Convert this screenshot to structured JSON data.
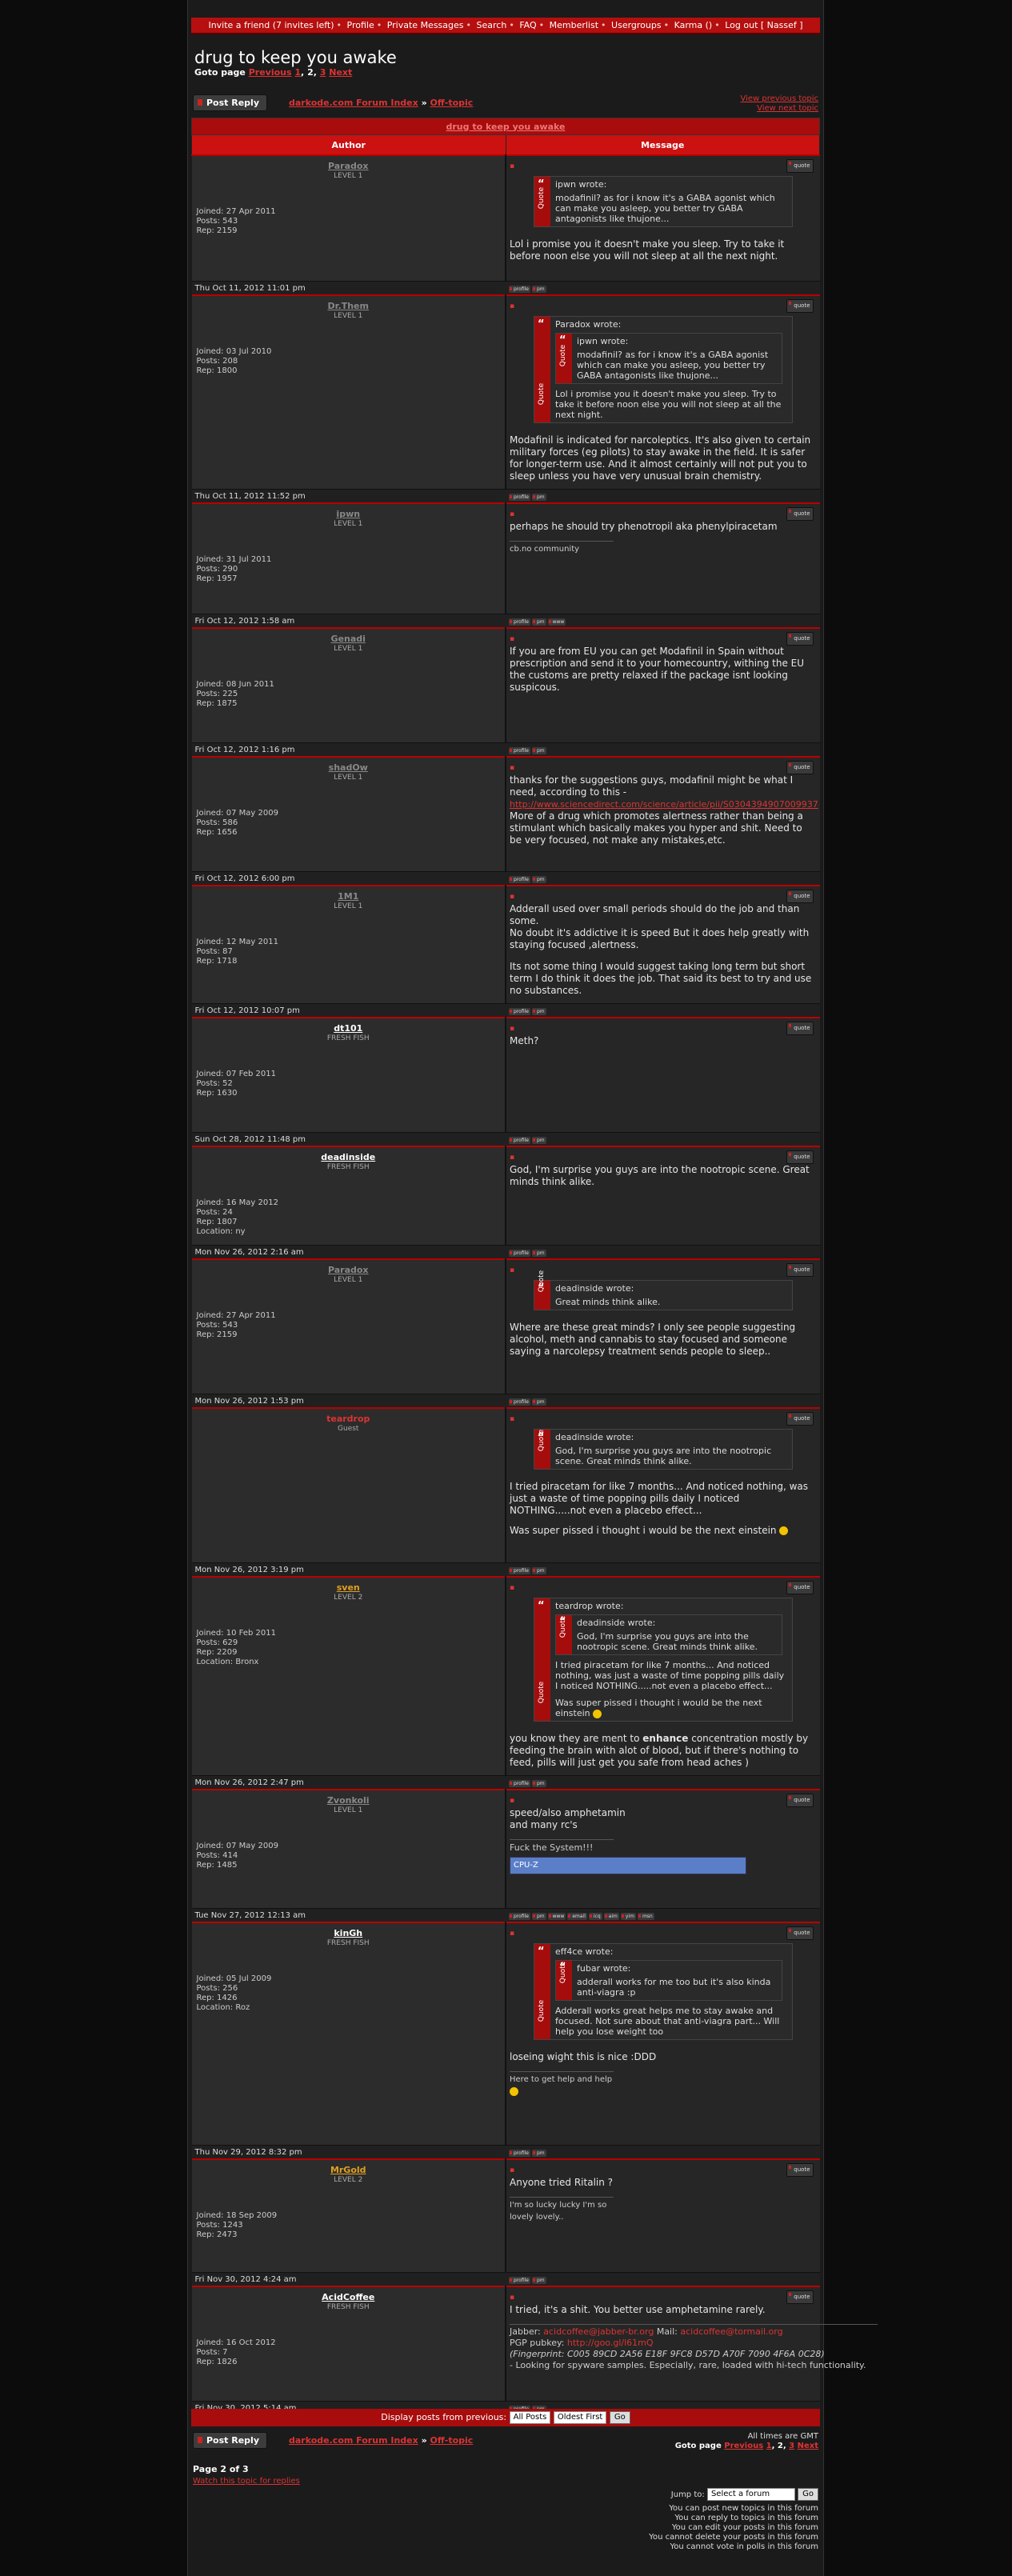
{
  "nav": [
    "Invite a friend (7 invites left)",
    "Profile",
    "Private Messages",
    "Search",
    "FAQ",
    "Memberlist",
    "Usergroups",
    "Karma ()",
    "Log out [ Nassef ]"
  ],
  "topic": {
    "title": "drug to keep you awake",
    "goto_prefix": "Goto page",
    "prev": "Previous",
    "pages": [
      "1",
      "2",
      "3"
    ],
    "current": "2",
    "next": "Next"
  },
  "toolbar": {
    "post_reply": "Post Reply",
    "forum_index": "darkode.com Forum Index",
    "sep": "»",
    "subforum": "Off-topic",
    "view_prev": "View previous topic",
    "view_next": "View next topic"
  },
  "table": {
    "topic_title": "drug to keep you awake",
    "col_author": "Author",
    "col_message": "Message"
  },
  "buttons": {
    "quote": "quote",
    "profile": "profile",
    "pm": "pm",
    "www": "www",
    "email": "email",
    "icq": "icq",
    "aim": "aim",
    "yim": "yim",
    "msn": "msn"
  },
  "posts": [
    {
      "author": "Paradox",
      "rank": "LEVEL 1",
      "joined": "Joined: 27 Apr 2011",
      "posts": "Posts: 543",
      "rep": "Rep: 2159",
      "date": "Thu Oct 11, 2012 11:01 pm",
      "quote_author": "ipwn wrote:",
      "quote_text": "modafinil? as for i know it's a GABA agonist which can make you asleep, you better try GABA antagonists like thujone...",
      "body": "Lol i promise you it doesn't make you sleep. Try to take it before noon else you will not sleep at all the next night."
    },
    {
      "author": "Dr.Them",
      "rank": "LEVEL 1",
      "joined": "Joined: 03 Jul 2010",
      "posts": "Posts: 208",
      "rep": "Rep: 1800",
      "date": "Thu Oct 11, 2012 11:52 pm",
      "quote_author": "Paradox wrote:",
      "inner_author": "ipwn wrote:",
      "inner_text": "modafinil? as for i know it's a GABA agonist which can make you asleep, you better try GABA antagonists like thujone...",
      "quote_text": "Lol i promise you it doesn't make you sleep. Try to take it before noon else you will not sleep at all the next night.",
      "body": "Modafinil is indicated for narcoleptics. It's also given to certain military forces (eg pilots) to stay awake in the field. It is safer for longer-term use. And it almost certainly will not put you to sleep unless you have very unusual brain chemistry."
    },
    {
      "author": "ipwn",
      "rank": "LEVEL 1",
      "joined": "Joined: 31 Jul 2011",
      "posts": "Posts: 290",
      "rep": "Rep: 1957",
      "date": "Fri Oct 12, 2012 1:58 am",
      "body": "perhaps he should try phenotropil aka phenylpiracetam",
      "sig": "cb.no community"
    },
    {
      "author": "Genadi",
      "rank": "LEVEL 1",
      "joined": "Joined: 08 Jun 2011",
      "posts": "Posts: 225",
      "rep": "Rep: 1875",
      "date": "Fri Oct 12, 2012 1:16 pm",
      "body": "If you are from EU you can get Modafinil in Spain without prescription and send it to your homecountry, withing the EU the customs are pretty relaxed if the package isnt looking suspicous."
    },
    {
      "author": "shadOw",
      "rank": "LEVEL 1",
      "joined": "Joined: 07 May 2009",
      "posts": "Posts: 586",
      "rep": "Rep: 1656",
      "date": "Fri Oct 12, 2012 6:00 pm",
      "body": "thanks for the suggestions guys, modafinil might be what I need, according to this -",
      "link": "http://www.sciencedirect.com/science/article/pii/S0304394907009937",
      "body2": "More of a drug which promotes alertness rather than being a stimulant which basically makes you hyper and shit. Need to be very focused, not make any mistakes,etc."
    },
    {
      "author": "1M1",
      "rank": "LEVEL 1",
      "joined": "Joined: 12 May 2011",
      "posts": "Posts: 87",
      "rep": "Rep: 1718",
      "date": "Fri Oct 12, 2012 10:07 pm",
      "body": "Adderall used over small periods should do the job and than some.",
      "body2": "No doubt it's addictive it is speed But it does help greatly with staying focused ,alertness.",
      "body3": "Its not some thing I would suggest taking long term but short term I do think it does the job. That said its best to try and use no substances."
    },
    {
      "author": "dt101",
      "rank": "FRESH FISH",
      "joined": "Joined: 07 Feb 2011",
      "posts": "Posts: 52",
      "rep": "Rep: 1630",
      "date": "Sun Oct 28, 2012 11:48 pm",
      "body": "Meth?"
    },
    {
      "author": "deadinside",
      "rank": "FRESH FISH",
      "joined": "Joined: 16 May 2012",
      "posts": "Posts: 24",
      "rep": "Rep: 1807",
      "location": "Location: ny",
      "date": "Mon Nov 26, 2012 2:16 am",
      "body": "God, I'm surprise you guys are into the nootropic scene. Great minds think alike."
    },
    {
      "author": "Paradox",
      "rank": "LEVEL 1",
      "joined": "Joined: 27 Apr 2011",
      "posts": "Posts: 543",
      "rep": "Rep: 2159",
      "date": "Mon Nov 26, 2012 1:53 pm",
      "quote_author": "deadinside wrote:",
      "quote_text": "Great minds think alike.",
      "body": "Where are these great minds? I only see people suggesting alcohol, meth and cannabis to stay focused and someone saying a narcolepsy treatment sends people to sleep.."
    },
    {
      "author": "teardrop",
      "rank": "Guest",
      "date": "Mon Nov 26, 2012 3:19 pm",
      "quote_author": "deadinside wrote:",
      "quote_text": "God, I'm surprise you guys are into the nootropic scene. Great minds think alike.",
      "body": "I tried piracetam for like 7 months... And noticed nothing, was just a waste of time popping pills daily I noticed NOTHING.....not even a placebo effect...",
      "body2": "Was super pissed i thought i would be the next einstein"
    },
    {
      "author": "sven",
      "rank": "LEVEL 2",
      "joined": "Joined: 10 Feb 2011",
      "posts": "Posts: 629",
      "rep": "Rep: 2209",
      "location": "Location: Bronx",
      "date": "Mon Nov 26, 2012 2:47 pm",
      "quote_author": "teardrop wrote:",
      "inner_author": "deadinside wrote:",
      "inner_text": "God, I'm surprise you guys are into the nootropic scene. Great minds think alike.",
      "quote_text": "I tried piracetam for like 7 months... And noticed nothing, was just a waste of time popping pills daily I noticed NOTHING.....not even a placebo effect...",
      "quote_text2": "Was super pissed i thought i would be the next einstein",
      "body_a": "you know they are ment to ",
      "body_b": "enhance",
      "body_c": " concentration mostly by feeding the brain with alot of blood, but if there's nothing to feed, pills will just get you safe from head aches )"
    },
    {
      "author": "Zvonkoli",
      "rank": "LEVEL 1",
      "joined": "Joined: 07 May 2009",
      "posts": "Posts: 414",
      "rep": "Rep: 1485",
      "date": "Tue Nov 27, 2012 12:13 am",
      "body": "speed/also amphetamin",
      "body2": "and many rc's",
      "sig": "Fuck the System!!!",
      "banner": "CPU-Z"
    },
    {
      "author": "kinGh",
      "rank": "FRESH FISH",
      "joined": "Joined: 05 Jul 2009",
      "posts": "Posts: 256",
      "rep": "Rep: 1426",
      "location": "Location: Roz",
      "date": "Thu Nov 29, 2012 8:32 pm",
      "quote_author": "eff4ce wrote:",
      "inner_author": "fubar wrote:",
      "inner_text": "adderall works for me too but it's also kinda anti-viagra :p",
      "quote_text": "Adderall works great helps me to stay awake and focused. Not sure about that anti-viagra part... Will help you lose weight too",
      "body": "loseing wight this is nice :DDD",
      "sig": "Here to get help and help"
    },
    {
      "author": "MrGold",
      "rank": "LEVEL 2",
      "joined": "Joined: 18 Sep 2009",
      "posts": "Posts: 1243",
      "rep": "Rep: 2473",
      "date": "Fri Nov 30, 2012 4:24 am",
      "body": "Anyone tried Ritalin ?",
      "sig": "I'm so lucky lucky I'm so lovely lovely.."
    },
    {
      "author": "AcidCoffee",
      "rank": "FRESH FISH",
      "joined": "Joined: 16 Oct 2012",
      "posts": "Posts: 7",
      "rep": "Rep: 1826",
      "date": "Fri Nov 30, 2012 5:14 am",
      "body": "I tried, it's a shit. You better use amphetamine rarely.",
      "jabber_label": "Jabber: ",
      "jabber": "acidcoffee@jabber-br.org",
      "mail_label": " Mail: ",
      "mail": "acidcoffee@tormail.org",
      "pgp_label": "PGP pubkey: ",
      "pgp": "http://goo.gl/l61mQ",
      "fingerprint": "(Fingerprint: C005 89CD 2A56 E18F 9FC8 D57D A70F 7090 4F6A 0C28)",
      "sig_line": "- Looking for spyware samples. Especially, rare, loaded with hi-tech functionality."
    }
  ],
  "display": {
    "label": "Display posts from previous:",
    "period": "All Posts",
    "order": "Oldest First",
    "go": "Go"
  },
  "bottom": {
    "timezone": "All times are GMT",
    "page_of": "Page 2 of 3",
    "watch": "Watch this topic for replies",
    "jump_label": "Jump to:",
    "jump_value": "Select a forum",
    "jump_go": "Go",
    "perms": [
      "You can post new topics in this forum",
      "You can reply to topics in this forum",
      "You can edit your posts in this forum",
      "You cannot delete your posts in this forum",
      "You cannot vote in polls in this forum"
    ]
  }
}
